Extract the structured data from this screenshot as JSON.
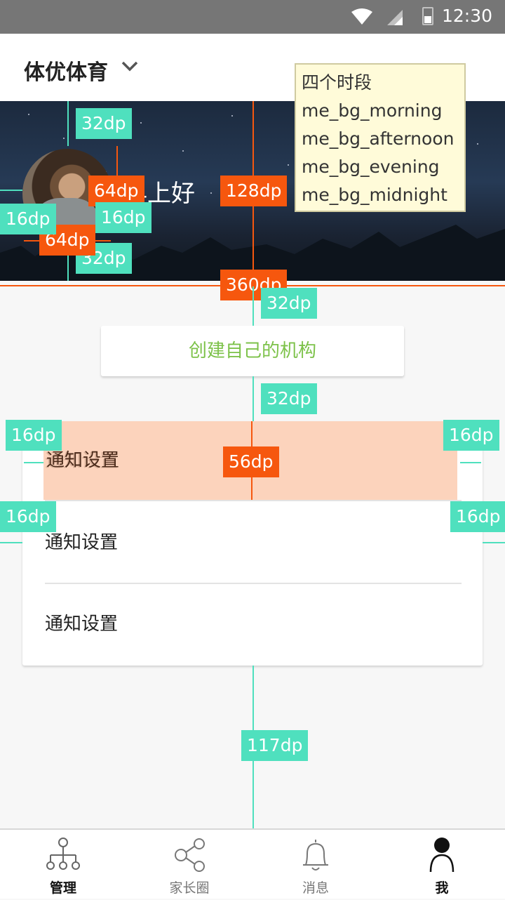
{
  "status": {
    "time": "12:30"
  },
  "header": {
    "title": "体优体育"
  },
  "hero": {
    "greeting": "早上好"
  },
  "note": {
    "title": "四个时段",
    "lines": [
      "me_bg_morning",
      "me_bg_afternoon",
      "me_bg_evening",
      "me_bg_midnight"
    ]
  },
  "actions": {
    "create_org": "创建自己的机构"
  },
  "settings": {
    "items": [
      "通知设置",
      "通知设置",
      "通知设置"
    ]
  },
  "dims": {
    "d32a": "32dp",
    "d32b": "32dp",
    "d32c": "32dp",
    "d32d": "32dp",
    "d64a": "64dp",
    "d64b": "64dp",
    "d16a": "16dp",
    "d16b": "16dp",
    "d16c": "16dp",
    "d16d": "16dp",
    "d16e": "16dp",
    "d16f": "16dp",
    "d128": "128dp",
    "d360": "360dp",
    "d56": "56dp",
    "d117": "117dp"
  },
  "nav": [
    {
      "label": "管理",
      "icon": "org-chart-icon",
      "active": true
    },
    {
      "label": "家长圈",
      "icon": "share-icon",
      "active": false
    },
    {
      "label": "消息",
      "icon": "bell-icon",
      "active": false
    },
    {
      "label": "我",
      "icon": "person-icon",
      "active": true
    }
  ],
  "colors": {
    "accent_green": "#7dc24a",
    "dim_teal": "#4fe0be",
    "dim_orange": "#f6570e",
    "highlight": "#fccbb0"
  }
}
